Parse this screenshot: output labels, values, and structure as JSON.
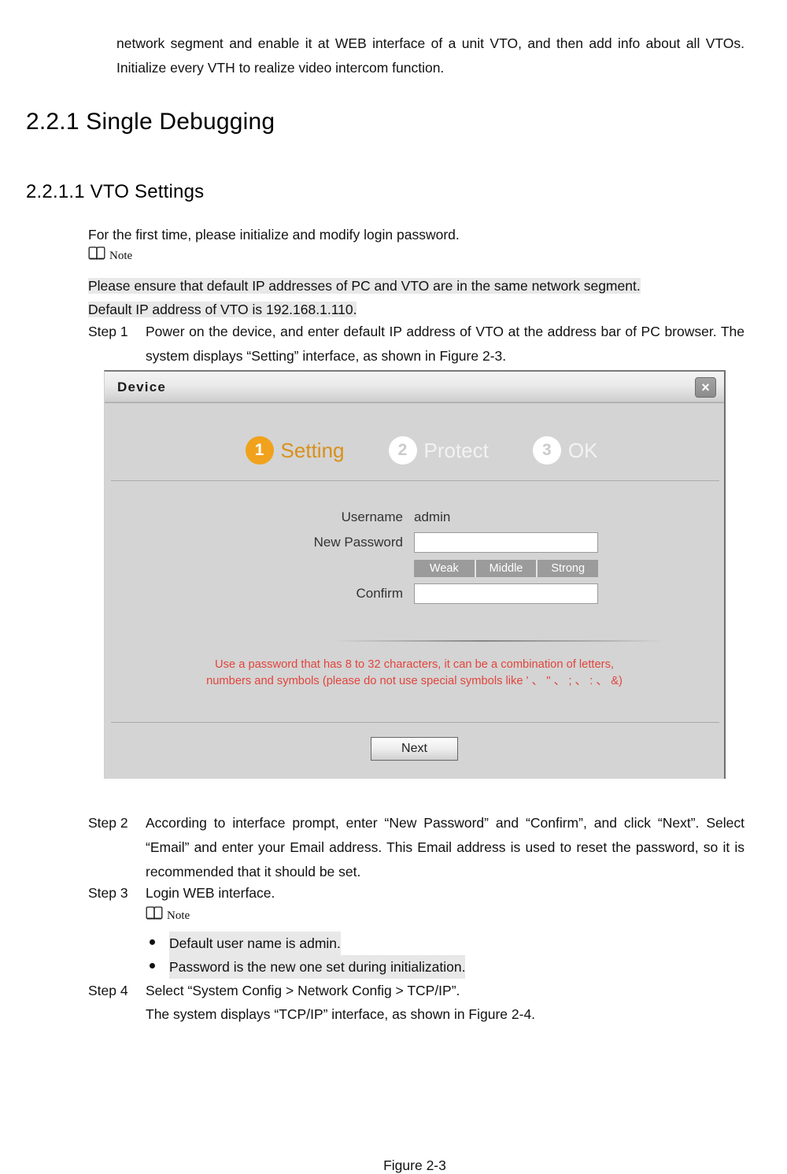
{
  "document": {
    "intro_paragraph": "network segment and enable it at WEB interface of a unit VTO, and then add info about all VTOs. Initialize every VTH to realize video intercom function.",
    "heading_2": "2.2.1 Single Debugging",
    "heading_3": "2.2.1.1 VTO Settings",
    "first_time_line": "For the first time, please initialize and modify login password.",
    "note_label_1": "Note",
    "note_body_line_1": "Please ensure that default IP addresses of PC and VTO are in the same network segment.",
    "note_body_line_2": "Default IP address of VTO is 192.168.1.110.",
    "steps": [
      {
        "tag": "Step 1",
        "body": "Power on the device, and enter default IP address of VTO at the address bar of PC browser. The system displays “Setting” interface, as shown in Figure 2-3."
      },
      {
        "tag": "Step 2",
        "body": "According to interface prompt, enter “New Password” and “Confirm”, and click “Next”. Select “Email” and enter your Email address. This Email address is used to reset the password, so it is recommended that it should be set."
      },
      {
        "tag": "Step 3",
        "body": "Login WEB interface."
      },
      {
        "tag": "Step 4",
        "body": "Select “System Config > Network Config > TCP/IP”."
      }
    ],
    "step4_sub_line": "The system displays “TCP/IP” interface, as shown in Figure 2-4.",
    "note_label_2": "Note",
    "note_bullets": [
      "Default user name is admin.",
      "Password is the new one set during initialization."
    ],
    "figure_caption": "Figure 2-3"
  },
  "dialog": {
    "title": "Device",
    "close_label": "×",
    "wizard": [
      {
        "number": "1",
        "label": "Setting",
        "state": "active"
      },
      {
        "number": "2",
        "label": "Protect",
        "state": "idle"
      },
      {
        "number": "3",
        "label": "OK",
        "state": "idle"
      }
    ],
    "form": {
      "username_label": "Username",
      "username_value": "admin",
      "new_password_label": "New Password",
      "new_password_value": "",
      "confirm_label": "Confirm",
      "confirm_value": "",
      "strength": [
        "Weak",
        "Middle",
        "Strong"
      ]
    },
    "warning_line_1": "Use a password that has 8 to 32 characters, it can be a combination of letters,",
    "warning_line_2": "numbers and symbols (please do not use special symbols like ' 、 \" 、 ; 、 : 、 &)",
    "next_label": "Next",
    "colors": {
      "accent_orange": "#f0a21c",
      "active_label": "#d9901a",
      "warning_red": "#e1453c",
      "dialog_bg": "#d4d4d4",
      "highlight_gray": "#e8e8e8"
    }
  }
}
